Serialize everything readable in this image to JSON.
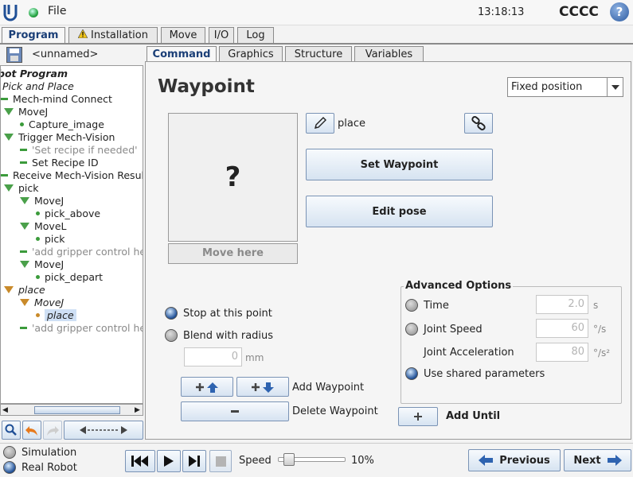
{
  "topbar": {
    "file_label": "File",
    "time": "13:18:13",
    "robot_name": "CCCC",
    "help": "?"
  },
  "main_tabs": [
    "Program",
    "Installation",
    "Move",
    "I/O",
    "Log"
  ],
  "file_name": "<unnamed>",
  "tree": [
    {
      "label": "bot Program",
      "style": "bold-italic",
      "indent": 0
    },
    {
      "label": "Pick and Place",
      "style": "italic",
      "indent": 0
    },
    {
      "label": "Mech-mind Connect",
      "style": "dash",
      "indent": 0
    },
    {
      "label": "MoveJ",
      "style": "tri",
      "indent": 1
    },
    {
      "label": "Capture_image",
      "style": "dot",
      "indent": 2
    },
    {
      "label": "Trigger Mech-Vision",
      "style": "tri",
      "indent": 1
    },
    {
      "label": "'Set recipe if needed'",
      "style": "dash-gray",
      "indent": 2
    },
    {
      "label": "Set Recipe ID",
      "style": "dash",
      "indent": 2
    },
    {
      "label": "Receive Mech-Vision Resul",
      "style": "dash",
      "indent": 0
    },
    {
      "label": "pick",
      "style": "tri",
      "indent": 1
    },
    {
      "label": "MoveJ",
      "style": "tri",
      "indent": 2
    },
    {
      "label": "pick_above",
      "style": "dot",
      "indent": 3
    },
    {
      "label": "MoveL",
      "style": "tri",
      "indent": 2
    },
    {
      "label": "pick",
      "style": "dot",
      "indent": 3
    },
    {
      "label": "'add gripper control he",
      "style": "dash-gray",
      "indent": 2
    },
    {
      "label": "MoveJ",
      "style": "tri",
      "indent": 2
    },
    {
      "label": "pick_depart",
      "style": "dot",
      "indent": 3
    },
    {
      "label": "place",
      "style": "tri-o-italic",
      "indent": 1
    },
    {
      "label": "MoveJ",
      "style": "tri-o-italic",
      "indent": 2
    },
    {
      "label": "place",
      "style": "dot-o-selected",
      "indent": 3
    },
    {
      "label": "'add gripper control he",
      "style": "dash-gray",
      "indent": 2
    }
  ],
  "sub_tabs": [
    "Command",
    "Graphics",
    "Structure",
    "Variables"
  ],
  "waypoint": {
    "title": "Waypoint",
    "position_mode": "Fixed position",
    "preview_symbol": "?",
    "move_here": "Move here",
    "name": "place",
    "set_waypoint": "Set Waypoint",
    "edit_pose": "Edit pose",
    "stop_label": "Stop at this point",
    "blend_label": "Blend with radius",
    "blend_value": "0",
    "blend_unit": "mm",
    "add_waypoint": "Add Waypoint",
    "delete_waypoint": "Delete Waypoint",
    "add_until": "Add Until"
  },
  "advanced": {
    "title": "Advanced Options",
    "time_label": "Time",
    "time_value": "2.0",
    "time_unit": "s",
    "speed_label": "Joint Speed",
    "speed_value": "60",
    "speed_unit": "°/s",
    "accel_label": "Joint Acceleration",
    "accel_value": "80",
    "accel_unit": "°/s²",
    "shared_label": "Use shared parameters"
  },
  "bottom": {
    "simulation": "Simulation",
    "real_robot": "Real Robot",
    "speed_label": "Speed",
    "speed_value": "10%",
    "speed_fraction": 0.1,
    "previous": "Previous",
    "next": "Next"
  },
  "colors": {
    "accent": "#1b3f77",
    "button": "#d6e3f1",
    "selection": "#cfe0f5"
  }
}
